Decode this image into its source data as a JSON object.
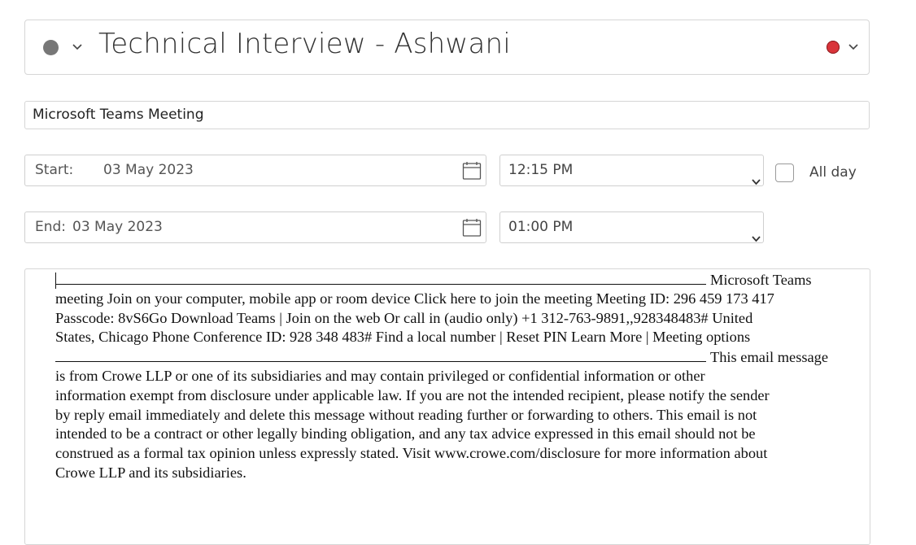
{
  "event": {
    "title": "Technical Interview - Ashwani",
    "status_color": "#777777",
    "category_color": "#d9343a"
  },
  "location": {
    "value": "Microsoft Teams Meeting"
  },
  "start": {
    "label": "Start:",
    "date": "03 May 2023",
    "time": "12:15 PM"
  },
  "end": {
    "label": "End:",
    "date": "03 May 2023",
    "time": "01:00 PM"
  },
  "all_day": {
    "label": "All day",
    "checked": false
  },
  "icons": {
    "status": "circle-icon",
    "dropdown": "chevron-down-icon",
    "calendar": "calendar-icon"
  },
  "body": {
    "lines": [
      "Microsoft Teams",
      "meeting Join on your computer, mobile app or room device Click here to join the meeting Meeting ID: 296 459 173 417",
      "Passcode: 8vS6Go Download Teams | Join on the web Or call in (audio only) +1 312-763-9891,,928348483# United",
      "States, Chicago Phone Conference ID: 928 348 483# Find a local number | Reset PIN Learn More | Meeting options",
      "This email message",
      "is from Crowe LLP or one of its subsidiaries and may contain privileged or confidential information or other",
      "information exempt from disclosure under applicable law. If you are not the intended recipient, please notify the sender",
      "by reply email immediately and delete this message without reading further or forwarding to others. This email is not",
      "intended to be a contract or other legally binding obligation, and any tax advice expressed in this email should not be",
      "construed as a formal tax opinion unless expressly stated. Visit www.crowe.com/disclosure for more information about",
      "Crowe LLP and its subsidiaries."
    ]
  }
}
